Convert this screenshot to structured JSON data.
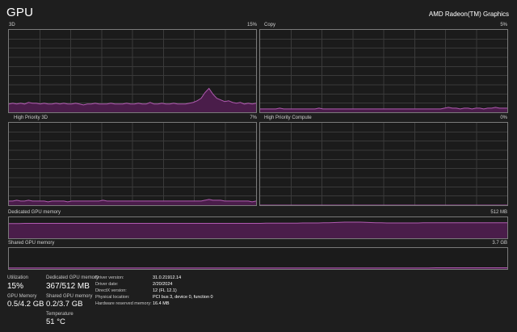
{
  "header": {
    "title": "GPU",
    "device_name": "AMD Radeon(TM) Graphics"
  },
  "graphs": {
    "3d": {
      "label": "3D",
      "max_label": "15%"
    },
    "copy": {
      "label": "Copy",
      "max_label": "5%"
    },
    "high_priority_3d": {
      "label": "High Priority 3D",
      "max_label": "7%"
    },
    "high_priority_compute": {
      "label": "High Priority Compute",
      "max_label": "0%"
    },
    "dedicated_memory": {
      "label": "Dedicated GPU memory",
      "max_label": "512 MB"
    },
    "shared_memory": {
      "label": "Shared GPU memory",
      "max_label": "3.7 GB"
    }
  },
  "stats": {
    "utilization": {
      "label": "Utilization",
      "value": "15%"
    },
    "dedicated_gpu_memory": {
      "label": "Dedicated GPU memory",
      "value": "367/512 MB"
    },
    "gpu_memory": {
      "label": "GPU Memory",
      "value": "0.5/4.2 GB"
    },
    "shared_gpu_memory": {
      "label": "Shared GPU memory",
      "value": "0.2/3.7 GB"
    },
    "temperature": {
      "label": "Temperature",
      "value": "51 °C"
    }
  },
  "details": [
    {
      "label": "Driver version:",
      "value": "31.0.21912.14"
    },
    {
      "label": "Driver date:",
      "value": "2/20/2024"
    },
    {
      "label": "DirectX version:",
      "value": "12 (FL 12.1)"
    },
    {
      "label": "Physical location:",
      "value": "PCI bus 3, device 0, function 0"
    },
    {
      "label": "Hardware reserved memory:",
      "value": "16.4 MB"
    }
  ],
  "colors": {
    "line": "#b05ab0",
    "fill": "#4a1d4a",
    "grid": "#3a3a3a",
    "border": "#7a7a7a"
  },
  "series": {
    "3d": [
      0.1,
      0.11,
      0.1,
      0.11,
      0.1,
      0.12,
      0.11,
      0.11,
      0.1,
      0.11,
      0.1,
      0.1,
      0.11,
      0.1,
      0.11,
      0.1,
      0.1,
      0.11,
      0.1,
      0.09,
      0.1,
      0.1,
      0.11,
      0.1,
      0.1,
      0.1,
      0.11,
      0.1,
      0.1,
      0.1,
      0.11,
      0.1,
      0.1,
      0.11,
      0.1,
      0.1,
      0.12,
      0.1,
      0.1,
      0.11,
      0.1,
      0.1,
      0.11,
      0.1,
      0.1,
      0.1,
      0.11,
      0.12,
      0.14,
      0.17,
      0.24,
      0.29,
      0.22,
      0.17,
      0.15,
      0.13,
      0.14,
      0.12,
      0.11,
      0.12,
      0.1,
      0.11,
      0.1,
      0.11
    ],
    "copy": [
      0.04,
      0.04,
      0.04,
      0.04,
      0.04,
      0.05,
      0.04,
      0.04,
      0.04,
      0.04,
      0.04,
      0.04,
      0.04,
      0.04,
      0.04,
      0.05,
      0.04,
      0.04,
      0.04,
      0.04,
      0.04,
      0.04,
      0.04,
      0.04,
      0.04,
      0.04,
      0.04,
      0.04,
      0.04,
      0.04,
      0.04,
      0.04,
      0.04,
      0.04,
      0.04,
      0.04,
      0.04,
      0.04,
      0.04,
      0.04,
      0.04,
      0.04,
      0.04,
      0.04,
      0.04,
      0.04,
      0.04,
      0.05,
      0.06,
      0.05,
      0.05,
      0.04,
      0.05,
      0.05,
      0.04,
      0.05,
      0.05,
      0.04,
      0.05,
      0.05,
      0.06,
      0.05,
      0.05,
      0.05
    ],
    "high_priority_3d": [
      0.05,
      0.05,
      0.06,
      0.05,
      0.05,
      0.06,
      0.05,
      0.05,
      0.05,
      0.05,
      0.04,
      0.05,
      0.05,
      0.05,
      0.05,
      0.04,
      0.05,
      0.05,
      0.05,
      0.05,
      0.05,
      0.05,
      0.05,
      0.05,
      0.06,
      0.05,
      0.05,
      0.05,
      0.05,
      0.05,
      0.05,
      0.05,
      0.05,
      0.05,
      0.05,
      0.05,
      0.05,
      0.05,
      0.05,
      0.05,
      0.05,
      0.05,
      0.05,
      0.05,
      0.05,
      0.05,
      0.05,
      0.05,
      0.05,
      0.05,
      0.06,
      0.07,
      0.06,
      0.06,
      0.06,
      0.05,
      0.05,
      0.05,
      0.05,
      0.05,
      0.05,
      0.05,
      0.04,
      0.05
    ],
    "high_priority_compute": [
      0,
      0,
      0,
      0,
      0,
      0,
      0,
      0,
      0,
      0,
      0,
      0,
      0,
      0,
      0,
      0
    ],
    "dedicated_memory": [
      0.7,
      0.7,
      0.7,
      0.71,
      0.71,
      0.71,
      0.71,
      0.71,
      0.71,
      0.71,
      0.71,
      0.71,
      0.71,
      0.71,
      0.71,
      0.71,
      0.71,
      0.71,
      0.71,
      0.71,
      0.71,
      0.71,
      0.71,
      0.71,
      0.71,
      0.71,
      0.71,
      0.71,
      0.71,
      0.71,
      0.71,
      0.71,
      0.71,
      0.71,
      0.71,
      0.71,
      0.71,
      0.71,
      0.71,
      0.71,
      0.71,
      0.71,
      0.71,
      0.71,
      0.71,
      0.71,
      0.71,
      0.71,
      0.71,
      0.72,
      0.72,
      0.72,
      0.72,
      0.72,
      0.72,
      0.72,
      0.73,
      0.73,
      0.73,
      0.73,
      0.74,
      0.74,
      0.75,
      0.76,
      0.77,
      0.77,
      0.77,
      0.77,
      0.76,
      0.75,
      0.74,
      0.74,
      0.73,
      0.73,
      0.73,
      0.73,
      0.73,
      0.73,
      0.73,
      0.74,
      0.74,
      0.74,
      0.74,
      0.74,
      0.74,
      0.74,
      0.74,
      0.74,
      0.74,
      0.74,
      0.74,
      0.74,
      0.74,
      0.74,
      0.74,
      0.74
    ],
    "shared_memory": [
      0.05,
      0.05,
      0.05,
      0.05,
      0.05,
      0.05,
      0.05,
      0.05,
      0.05,
      0.05,
      0.05,
      0.05,
      0.05,
      0.05,
      0.05,
      0.05,
      0.05,
      0.05,
      0.05,
      0.05,
      0.05,
      0.05,
      0.05,
      0.05,
      0.05,
      0.05,
      0.05,
      0.05,
      0.05,
      0.05,
      0.05,
      0.05,
      0.05,
      0.05,
      0.05,
      0.05,
      0.05,
      0.05,
      0.05,
      0.05,
      0.05,
      0.05,
      0.05,
      0.05,
      0.05,
      0.05,
      0.05,
      0.05,
      0.05,
      0.05,
      0.05,
      0.05,
      0.05,
      0.05,
      0.06,
      0.06,
      0.06,
      0.06,
      0.06,
      0.06,
      0.06,
      0.06,
      0.06,
      0.06
    ]
  }
}
